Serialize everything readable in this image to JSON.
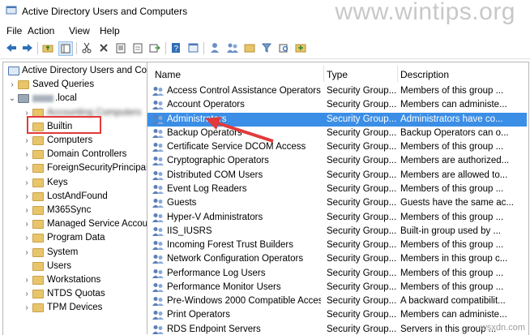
{
  "window": {
    "title": "Active Directory Users and Computers",
    "watermark": "www.wintips.org"
  },
  "menu": [
    "File",
    "Action",
    "View",
    "Help"
  ],
  "toolbar": [
    "back-icon",
    "forward-icon",
    "up-folder-icon",
    "console-tree-icon",
    "cut-icon",
    "delete-icon",
    "properties-icon",
    "refresh-icon",
    "export-icon",
    "help-icon",
    "console-icon",
    "add-user-icon",
    "add-group-icon",
    "add-ou-icon",
    "filter-icon",
    "find-icon",
    "add-to-group-icon"
  ],
  "tree": {
    "root": "Active Directory Users and Com",
    "items": [
      {
        "label": "Saved Queries",
        "indent": 1,
        "chevron": "right"
      },
      {
        "label": ".local",
        "indent": 1,
        "chevron": "down",
        "blurred_prefix": true
      },
      {
        "label": "Accounting Computers",
        "indent": 2,
        "chevron": "right",
        "blurred": true
      },
      {
        "label": "Builtin",
        "indent": 2,
        "chevron": "",
        "highlighted": true
      },
      {
        "label": "Computers",
        "indent": 2,
        "chevron": "right"
      },
      {
        "label": "Domain Controllers",
        "indent": 2,
        "chevron": "right"
      },
      {
        "label": "ForeignSecurityPrincipals",
        "indent": 2,
        "chevron": "right"
      },
      {
        "label": "Keys",
        "indent": 2,
        "chevron": "right"
      },
      {
        "label": "LostAndFound",
        "indent": 2,
        "chevron": "right"
      },
      {
        "label": "M365Sync",
        "indent": 2,
        "chevron": "right"
      },
      {
        "label": "Managed Service Accoun",
        "indent": 2,
        "chevron": "right"
      },
      {
        "label": "Program Data",
        "indent": 2,
        "chevron": "right"
      },
      {
        "label": "System",
        "indent": 2,
        "chevron": "right"
      },
      {
        "label": "Users",
        "indent": 2,
        "chevron": ""
      },
      {
        "label": "Workstations",
        "indent": 2,
        "chevron": "right"
      },
      {
        "label": "NTDS Quotas",
        "indent": 2,
        "chevron": "right"
      },
      {
        "label": "TPM Devices",
        "indent": 2,
        "chevron": "right"
      }
    ]
  },
  "list": {
    "columns": [
      "Name",
      "Type",
      "Description"
    ],
    "rows": [
      {
        "name": "Access Control Assistance Operators",
        "type": "Security Group...",
        "desc": "Members of this group ..."
      },
      {
        "name": "Account Operators",
        "type": "Security Group...",
        "desc": "Members can administe..."
      },
      {
        "name": "Administrators",
        "type": "Security Group...",
        "desc": "Administrators have co...",
        "selected": true
      },
      {
        "name": "Backup Operators",
        "type": "Security Group...",
        "desc": "Backup Operators can o..."
      },
      {
        "name": "Certificate Service DCOM Access",
        "type": "Security Group...",
        "desc": "Members of this group ..."
      },
      {
        "name": "Cryptographic Operators",
        "type": "Security Group...",
        "desc": "Members are authorized..."
      },
      {
        "name": "Distributed COM Users",
        "type": "Security Group...",
        "desc": "Members are allowed to..."
      },
      {
        "name": "Event Log Readers",
        "type": "Security Group...",
        "desc": "Members of this group ..."
      },
      {
        "name": "Guests",
        "type": "Security Group...",
        "desc": "Guests have the same ac..."
      },
      {
        "name": "Hyper-V Administrators",
        "type": "Security Group...",
        "desc": "Members of this group ..."
      },
      {
        "name": "IIS_IUSRS",
        "type": "Security Group...",
        "desc": "Built-in group used by ..."
      },
      {
        "name": "Incoming Forest Trust Builders",
        "type": "Security Group...",
        "desc": "Members of this group ..."
      },
      {
        "name": "Network Configuration Operators",
        "type": "Security Group...",
        "desc": "Members in this group c..."
      },
      {
        "name": "Performance Log Users",
        "type": "Security Group...",
        "desc": "Members of this group ..."
      },
      {
        "name": "Performance Monitor Users",
        "type": "Security Group...",
        "desc": "Members of this group ..."
      },
      {
        "name": "Pre-Windows 2000 Compatible Access",
        "type": "Security Group...",
        "desc": "A backward compatibilit..."
      },
      {
        "name": "Print Operators",
        "type": "Security Group...",
        "desc": "Members can administe..."
      },
      {
        "name": "RDS Endpoint Servers",
        "type": "Security Group...",
        "desc": "Servers in this group ..."
      }
    ]
  },
  "site_badge": "wsxdn.com",
  "colors": {
    "selection": "#3b8ee6",
    "highlight_box": "#e23a3a",
    "arrow": "#e23a3a",
    "folder": "#e8c56a"
  }
}
